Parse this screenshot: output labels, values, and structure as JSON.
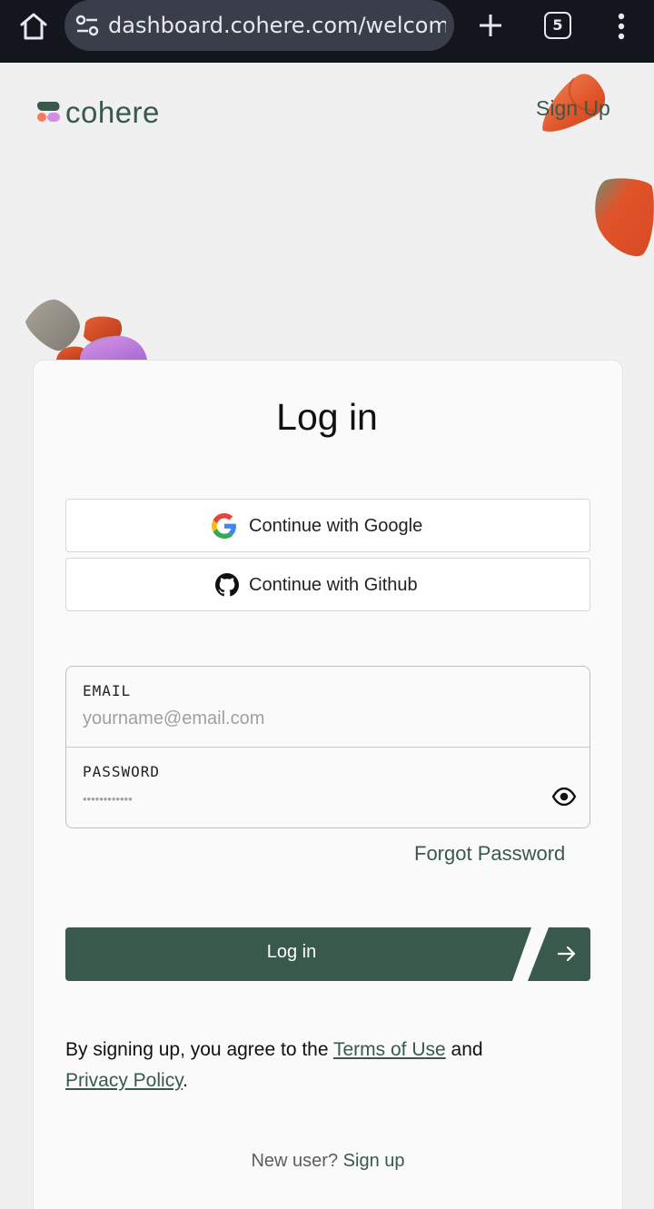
{
  "browser": {
    "url": "dashboard.cohere.com/welcome/login",
    "tab_count": "5"
  },
  "header": {
    "brand": "cohere",
    "signup_label": "Sign Up"
  },
  "login": {
    "title": "Log in",
    "google_label": "Continue with Google",
    "github_label": "Continue with Github",
    "email_label": "EMAIL",
    "email_placeholder": "yourname@email.com",
    "password_label": "PASSWORD",
    "password_placeholder": "••••••••••••",
    "forgot_label": "Forgot Password",
    "submit_label": "Log in"
  },
  "legal": {
    "prefix": "By signing up, you agree to the ",
    "terms_label": "Terms of Use",
    "middle": " and",
    "privacy_label": "Privacy Policy",
    "suffix": "."
  },
  "footer": {
    "new_user_text": "New user?",
    "signup_link": "Sign up"
  },
  "colors": {
    "brand_green": "#39594d",
    "background": "#eff0ef",
    "accent_orange": "#e0542a"
  },
  "icons": [
    "home-icon",
    "site-info-icon",
    "plus-icon",
    "tabs-icon",
    "more-vertical-icon",
    "google-icon",
    "github-icon",
    "eye-icon",
    "arrow-right-icon"
  ]
}
